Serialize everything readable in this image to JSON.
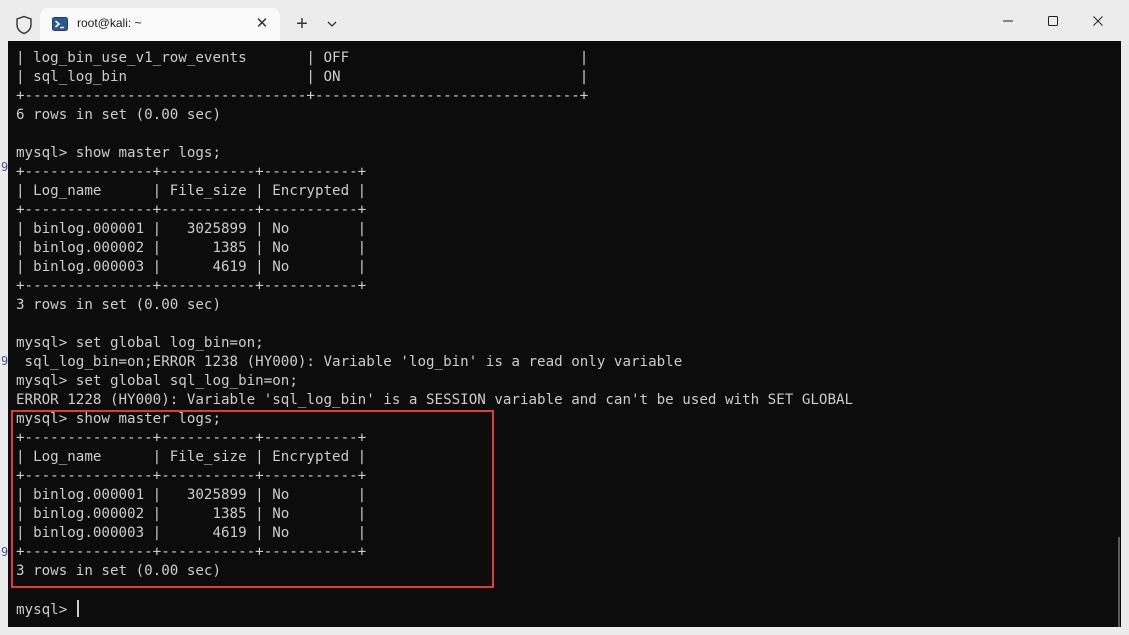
{
  "titlebar": {
    "tab_title": "root@kali: ~",
    "tab_close_glyph": "✕",
    "new_tab_glyph": "+",
    "icons": {
      "shield": "shield-icon",
      "terminal": "powershell-terminal-icon",
      "dropdown": "chevron-down-icon",
      "minimize": "minimize-icon",
      "maximize": "maximize-icon",
      "close": "close-icon"
    }
  },
  "terminal": {
    "lines": [
      "| log_bin_use_v1_row_events       | OFF                           |",
      "| sql_log_bin                     | ON                            |",
      "+---------------------------------+-------------------------------+",
      "6 rows in set (0.00 sec)",
      "",
      "mysql> show master logs;",
      "+---------------+-----------+-----------+",
      "| Log_name      | File_size | Encrypted |",
      "+---------------+-----------+-----------+",
      "| binlog.000001 |   3025899 | No        |",
      "| binlog.000002 |      1385 | No        |",
      "| binlog.000003 |      4619 | No        |",
      "+---------------+-----------+-----------+",
      "3 rows in set (0.00 sec)",
      "",
      "mysql> set global log_bin=on;",
      " sql_log_bin=on;ERROR 1238 (HY000): Variable 'log_bin' is a read only variable",
      "mysql> set global sql_log_bin=on;",
      "ERROR 1228 (HY000): Variable 'sql_log_bin' is a SESSION variable and can't be used with SET GLOBAL",
      "mysql> show master logs;",
      "+---------------+-----------+-----------+",
      "| Log_name      | File_size | Encrypted |",
      "+---------------+-----------+-----------+",
      "| binlog.000001 |   3025899 | No        |",
      "| binlog.000002 |      1385 | No        |",
      "| binlog.000003 |      4619 | No        |",
      "+---------------+-----------+-----------+",
      "3 rows in set (0.00 sec)",
      ""
    ],
    "prompt": "mysql> ",
    "edge_glyphs": [
      "9",
      "9",
      "9"
    ]
  },
  "colors": {
    "terminal_bg": "#0c0c0c",
    "terminal_fg": "#cccccc",
    "highlight_border": "#e03b3b",
    "titlebar_bg": "#ececec",
    "tab_bg": "#fafafa"
  }
}
